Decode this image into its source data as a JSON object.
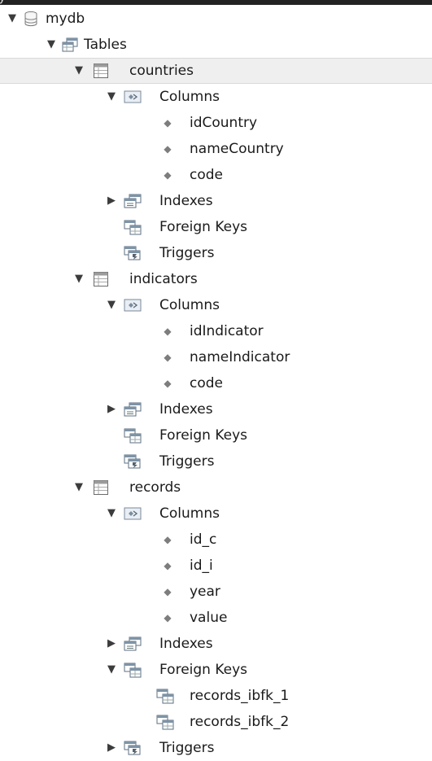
{
  "top_fragment": "y",
  "tree": {
    "schema_label": "mydb",
    "tables_label": "Tables",
    "tables": [
      {
        "name": "countries",
        "columns_label": "Columns",
        "columns": [
          "idCountry",
          "nameCountry",
          "code"
        ],
        "indexes_label": "Indexes",
        "foreign_keys_label": "Foreign Keys",
        "triggers_label": "Triggers"
      },
      {
        "name": "indicators",
        "columns_label": "Columns",
        "columns": [
          "idIndicator",
          "nameIndicator",
          "code"
        ],
        "indexes_label": "Indexes",
        "foreign_keys_label": "Foreign Keys",
        "triggers_label": "Triggers"
      },
      {
        "name": "records",
        "columns_label": "Columns",
        "columns": [
          "id_c",
          "id_i",
          "year",
          "value"
        ],
        "indexes_label": "Indexes",
        "foreign_keys_label": "Foreign Keys",
        "foreign_keys": [
          "records_ibfk_1",
          "records_ibfk_2"
        ],
        "triggers_label": "Triggers"
      }
    ]
  },
  "icons": {
    "expanded": "triangle-down-icon",
    "collapsed": "triangle-right-icon",
    "schema": "database-icon",
    "tables": "tables-folder-icon",
    "table": "table-icon",
    "columns": "columns-folder-icon",
    "column": "column-diamond-icon",
    "indexes": "indexes-icon",
    "foreign_keys": "foreign-keys-icon",
    "triggers": "triggers-icon",
    "foreign_key": "foreign-key-icon"
  },
  "colors": {
    "selected_row_bg": "#efefef",
    "text": "#1a1a1a",
    "topbar": "#222222"
  }
}
